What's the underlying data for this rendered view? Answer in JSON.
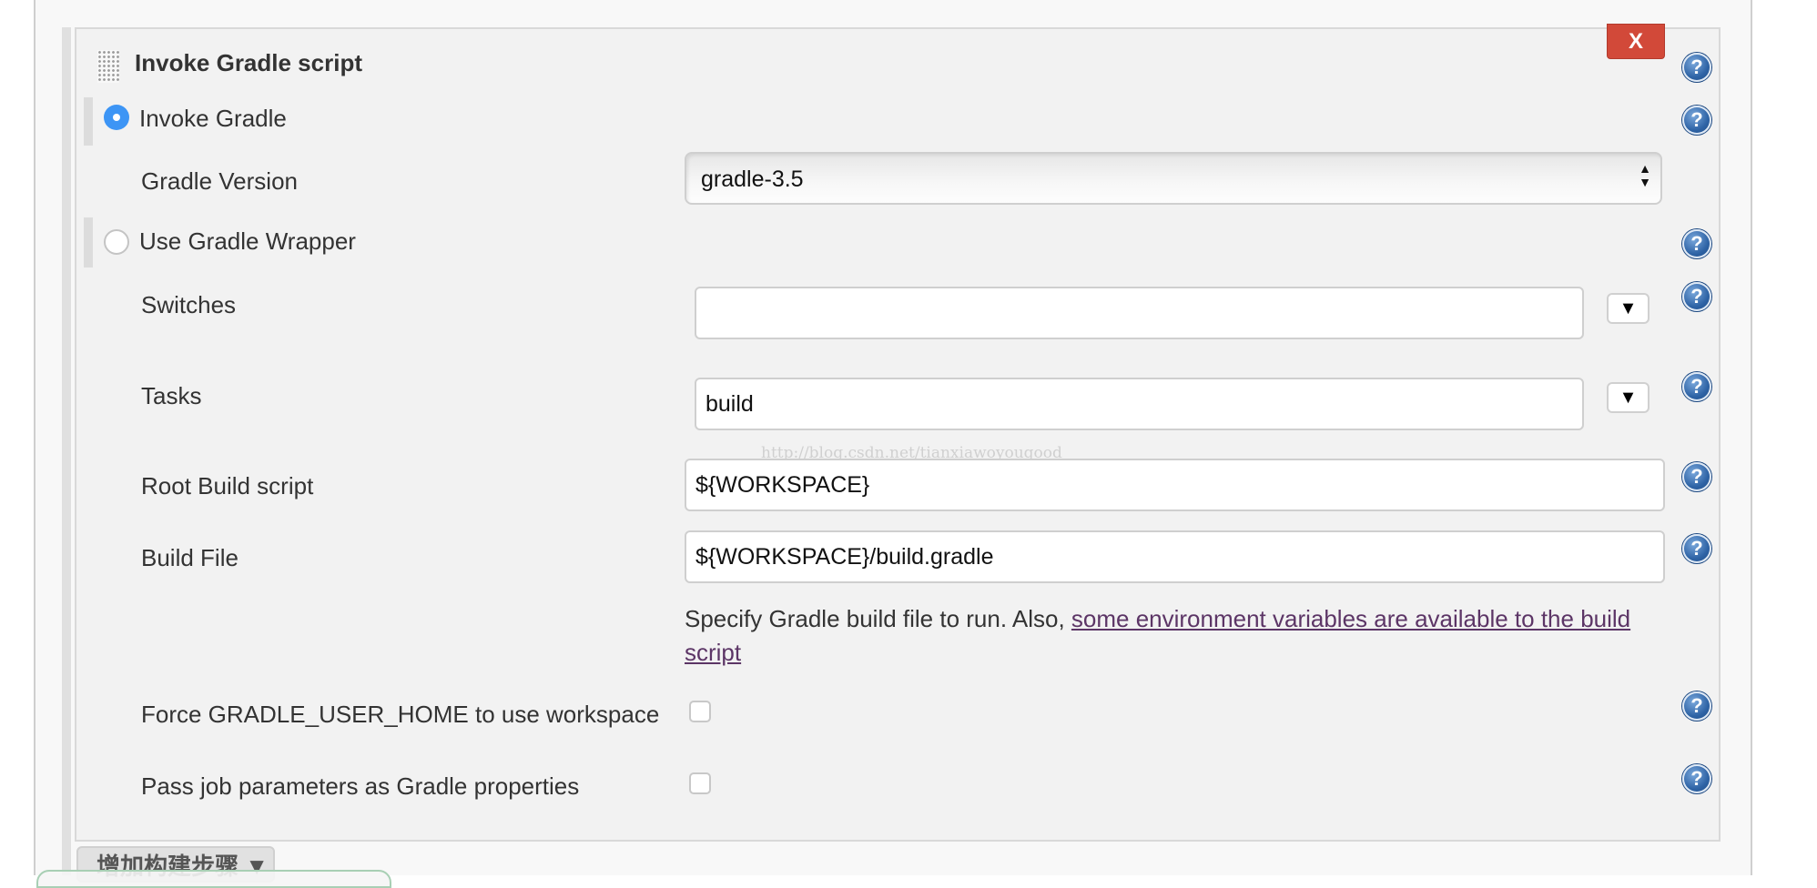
{
  "step": {
    "title": "Invoke Gradle script",
    "delete_label": "X",
    "help_glyph": "?",
    "icons": {
      "drag": "drag-handle-icon",
      "help": "help-icon",
      "expand": "triangle-down-icon"
    }
  },
  "invoke_gradle": {
    "label": "Invoke Gradle",
    "selected": true,
    "version_label": "Gradle Version",
    "version_value": "gradle-3.5",
    "select_arrows": "▲\n▼"
  },
  "wrapper": {
    "label": "Use Gradle Wrapper",
    "selected": false
  },
  "fields": {
    "switches": {
      "label": "Switches",
      "value": ""
    },
    "tasks": {
      "label": "Tasks",
      "value": "build"
    },
    "root_build_script": {
      "label": "Root Build script",
      "value": "${WORKSPACE}"
    },
    "build_file": {
      "label": "Build File",
      "value": "${WORKSPACE}/build.gradle"
    },
    "expand_glyph": "▼"
  },
  "build_file_help": {
    "text": "Specify Gradle build file to run. Also, ",
    "link": "some environment variables are available to the build script"
  },
  "options": {
    "force_user_home": {
      "label": "Force GRADLE_USER_HOME to use workspace",
      "checked": false
    },
    "pass_job_params": {
      "label": "Pass job parameters as Gradle properties",
      "checked": false
    }
  },
  "watermark": "http://blog.csdn.net/tianxiawoyougood",
  "footer": {
    "add_step_label": "增加构建步骤 ▼"
  },
  "colors": {
    "delete_red": "#d24939",
    "radio_blue": "#3d95f5",
    "link_purple": "#5c3566"
  }
}
